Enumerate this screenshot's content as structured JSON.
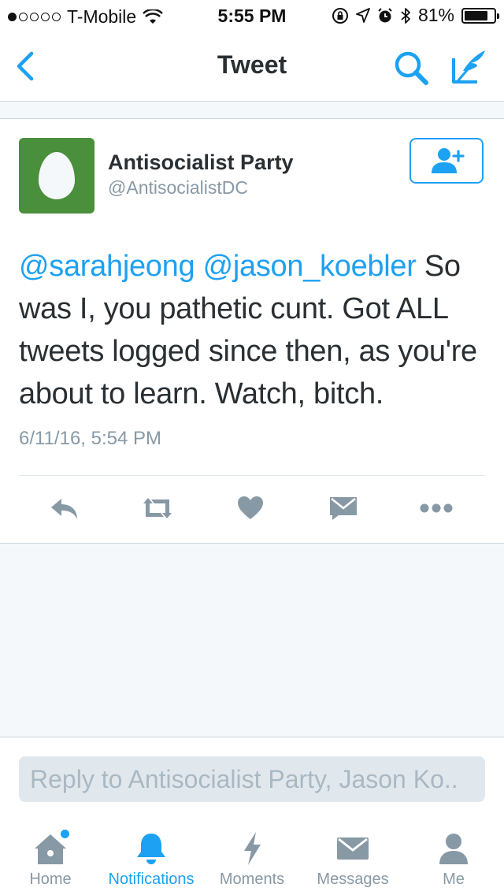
{
  "status_bar": {
    "carrier": "T-Mobile",
    "time": "5:55 PM",
    "battery": "81%",
    "battery_level": 0.81,
    "signal_bars_filled": 1,
    "signal_bars_total": 5
  },
  "nav": {
    "title": "Tweet",
    "back_icon": "chevron-left-icon",
    "search_icon": "search-icon",
    "compose_icon": "compose-icon"
  },
  "tweet": {
    "display_name": "Antisocialist Party",
    "screen_name": "@AntisocialistDC",
    "mention_1": "@sarahjeong",
    "mention_2": "@jason_koebler",
    "body": " So was I, you pathetic cunt.  Got ALL tweets logged since then, as you're about to learn.  Watch, bitch.",
    "timestamp": "6/11/16, 5:54 PM",
    "avatar_color": "#4a8f3c",
    "actions": [
      "reply-icon",
      "retweet-icon",
      "like-icon",
      "direct-message-icon",
      "more-icon"
    ]
  },
  "reply": {
    "placeholder": "Reply to Antisocialist Party, Jason Ko.."
  },
  "tabs": [
    {
      "label": "Home",
      "icon": "home-icon",
      "active": false,
      "has_dot": true
    },
    {
      "label": "Notifications",
      "icon": "bell-icon",
      "active": true
    },
    {
      "label": "Moments",
      "icon": "lightning-icon",
      "active": false
    },
    {
      "label": "Messages",
      "icon": "envelope-icon",
      "active": false
    },
    {
      "label": "Me",
      "icon": "person-icon",
      "active": false
    }
  ],
  "colors": {
    "accent": "#1da1f2",
    "icon_gray": "#8899a6",
    "text": "#292f33"
  }
}
